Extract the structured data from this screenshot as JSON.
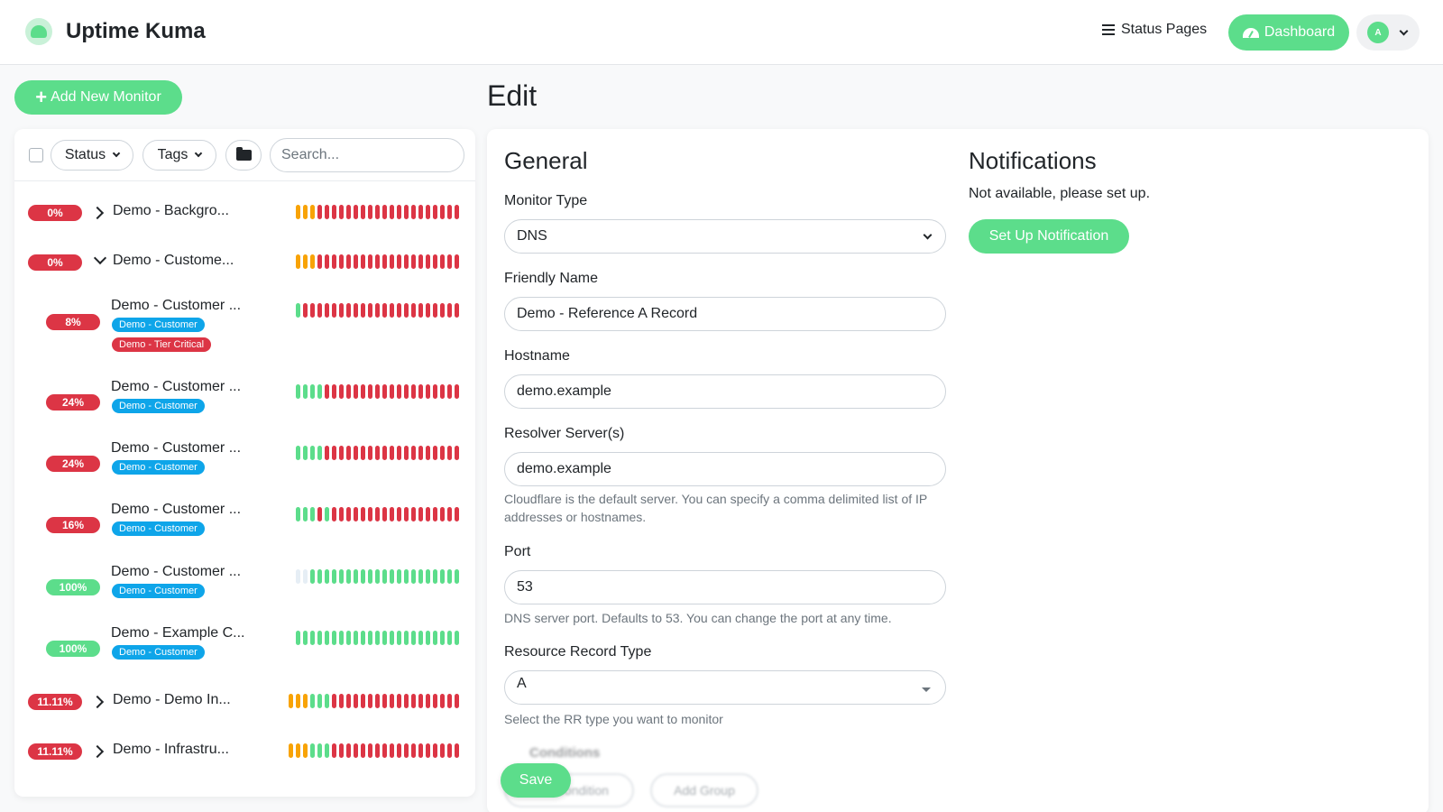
{
  "header": {
    "app_name": "Uptime Kuma",
    "status_pages": "Status Pages",
    "dashboard": "Dashboard",
    "avatar_initial": "A"
  },
  "sidebar": {
    "add_monitor": "Add New Monitor",
    "filters": {
      "status": "Status",
      "tags": "Tags"
    },
    "search_placeholder": "Search...",
    "monitors": [
      {
        "name": "Demo - Backgro...",
        "uptime": "0%",
        "status": "down",
        "expander": "collapsed",
        "tags": [],
        "beats": "yyyrrrrrrrrrrrrrrrrrrrr"
      },
      {
        "name": "Demo - Custome...",
        "uptime": "0%",
        "status": "down",
        "expander": "expanded",
        "tags": [],
        "beats": "yyyrrrrrrrrrrrrrrrrrrrr"
      },
      {
        "name": "Demo - Customer ...",
        "uptime": "8%",
        "status": "down",
        "expander": "child",
        "tags": [
          {
            "label": "Demo - Customer",
            "color": "#0ea5e9"
          },
          {
            "label": "Demo - Tier Critical",
            "color": "#dc3545"
          }
        ],
        "beats": "grrrrrrrrrrrrrrrrrrrrrr"
      },
      {
        "name": "Demo - Customer ...",
        "uptime": "24%",
        "status": "down",
        "expander": "child",
        "tags": [
          {
            "label": "Demo - Customer",
            "color": "#0ea5e9"
          }
        ],
        "beats": "ggggrrrrrrrrrrrrrrrrrrr"
      },
      {
        "name": "Demo - Customer ...",
        "uptime": "24%",
        "status": "down",
        "expander": "child",
        "tags": [
          {
            "label": "Demo - Customer",
            "color": "#0ea5e9"
          }
        ],
        "beats": "ggggrrrrrrrrrrrrrrrrrrr"
      },
      {
        "name": "Demo - Customer ...",
        "uptime": "16%",
        "status": "down",
        "expander": "child",
        "tags": [
          {
            "label": "Demo - Customer",
            "color": "#0ea5e9"
          }
        ],
        "beats": "gggrgrrrrrrrrrrrrrrrrrr"
      },
      {
        "name": "Demo - Customer ...",
        "uptime": "100%",
        "status": "up",
        "expander": "child",
        "tags": [
          {
            "label": "Demo - Customer",
            "color": "#0ea5e9"
          }
        ],
        "beats": "eeggggggggggggggggggggg"
      },
      {
        "name": "Demo - Example C...",
        "uptime": "100%",
        "status": "up",
        "expander": "child",
        "tags": [
          {
            "label": "Demo - Customer",
            "color": "#0ea5e9"
          }
        ],
        "beats": "ggggggggggggggggggggggg"
      },
      {
        "name": "Demo - Demo In...",
        "uptime": "11.11%",
        "status": "down",
        "expander": "collapsed",
        "tags": [],
        "beats": "yyygggrrrrrrrrrrrrrrrrrr"
      },
      {
        "name": "Demo - Infrastru...",
        "uptime": "11.11%",
        "status": "down",
        "expander": "collapsed",
        "tags": [],
        "beats": "yyygggrrrrrrrrrrrrrrrrrr"
      }
    ]
  },
  "colors": {
    "primary": "#5cdd8b",
    "down": "#dc3545",
    "up": "#5cdd8b",
    "pending": "#f8a306",
    "empty": "#e6eef5"
  },
  "edit": {
    "title": "Edit",
    "general": "General",
    "monitor_type_label": "Monitor Type",
    "monitor_type_value": "DNS",
    "friendly_name_label": "Friendly Name",
    "friendly_name_value": "Demo - Reference A Record",
    "hostname_label": "Hostname",
    "hostname_value": "demo.example",
    "resolver_label": "Resolver Server(s)",
    "resolver_value": "demo.example",
    "resolver_help": "Cloudflare is the default server. You can specify a comma delimited list of IP addresses or hostnames.",
    "port_label": "Port",
    "port_value": "53",
    "port_help": "DNS server port. Defaults to 53. You can change the port at any time.",
    "rr_label": "Resource Record Type",
    "rr_value": "A",
    "rr_help": "Select the RR type you want to monitor",
    "conditions_label": "Conditions",
    "add_condition": "Add Condition",
    "add_group": "Add Group",
    "save": "Save"
  },
  "notifications": {
    "title": "Notifications",
    "empty_text": "Not available, please set up.",
    "setup_button": "Set Up Notification"
  }
}
